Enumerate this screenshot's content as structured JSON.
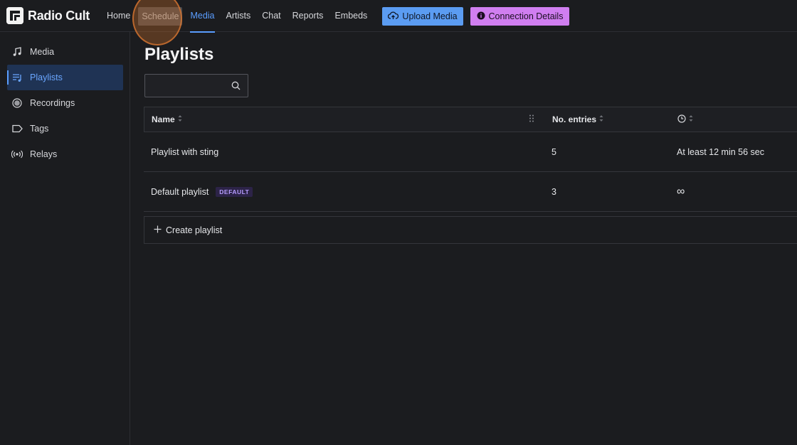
{
  "app": {
    "name": "Radio Cult"
  },
  "nav": {
    "items": [
      {
        "label": "Home"
      },
      {
        "label": "Schedule"
      },
      {
        "label": "Media"
      },
      {
        "label": "Artists"
      },
      {
        "label": "Chat"
      },
      {
        "label": "Reports"
      },
      {
        "label": "Embeds"
      }
    ],
    "active": "Media",
    "hovered": "Schedule",
    "upload_label": "Upload Media",
    "connection_label": "Connection Details"
  },
  "sidebar": {
    "items": [
      {
        "label": "Media",
        "icon": "music-note-icon"
      },
      {
        "label": "Playlists",
        "icon": "playlist-icon"
      },
      {
        "label": "Recordings",
        "icon": "record-icon"
      },
      {
        "label": "Tags",
        "icon": "tag-icon"
      },
      {
        "label": "Relays",
        "icon": "broadcast-icon"
      }
    ],
    "active": "Playlists"
  },
  "main": {
    "title": "Playlists",
    "search": {
      "placeholder": "",
      "value": ""
    },
    "table": {
      "columns": [
        {
          "label": "Name"
        },
        {
          "label": "No. entries"
        },
        {
          "label": "",
          "icon": "clock-icon"
        }
      ],
      "rows": [
        {
          "name": "Playlist with sting",
          "badge": "",
          "entries": "5",
          "duration": "At least 12 min 56 sec"
        },
        {
          "name": "Default playlist",
          "badge": "DEFAULT",
          "entries": "3",
          "duration": "∞"
        }
      ]
    },
    "create_label": "Create playlist"
  },
  "colors": {
    "accent_blue": "#5a9dff",
    "upload_button": "#5b9cf2",
    "connection_button": "#d07ef0",
    "default_badge": "#b69cff",
    "background": "#1b1c1f"
  }
}
